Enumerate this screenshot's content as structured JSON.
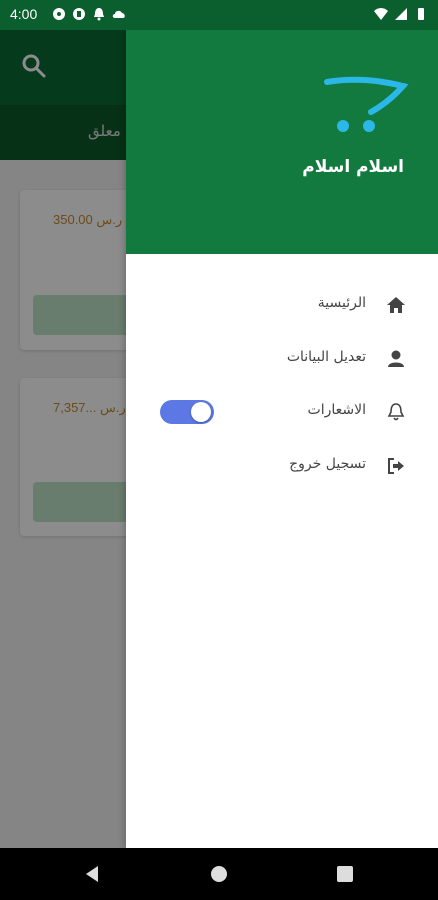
{
  "status_bar": {
    "time": "4:00"
  },
  "background_app": {
    "tab_label": "معلق",
    "cards": [
      {
        "price": "350.00 ر.س"
      },
      {
        "price": "7,357... ر.س"
      }
    ]
  },
  "drawer": {
    "username": "اسلام اسلام",
    "menu": [
      {
        "label": "الرئيسية",
        "icon": "home-icon"
      },
      {
        "label": "تعديل البيانات",
        "icon": "user-icon"
      },
      {
        "label": "الاشعارات",
        "icon": "bell-icon",
        "toggle_on": true
      },
      {
        "label": "تسجيل خروج",
        "icon": "logout-icon"
      }
    ]
  },
  "colors": {
    "header_green": "#127a3f",
    "accent_blue": "#5b78e4",
    "logo_cyan": "#2bb8e8",
    "price_orange": "#c58a2b"
  }
}
